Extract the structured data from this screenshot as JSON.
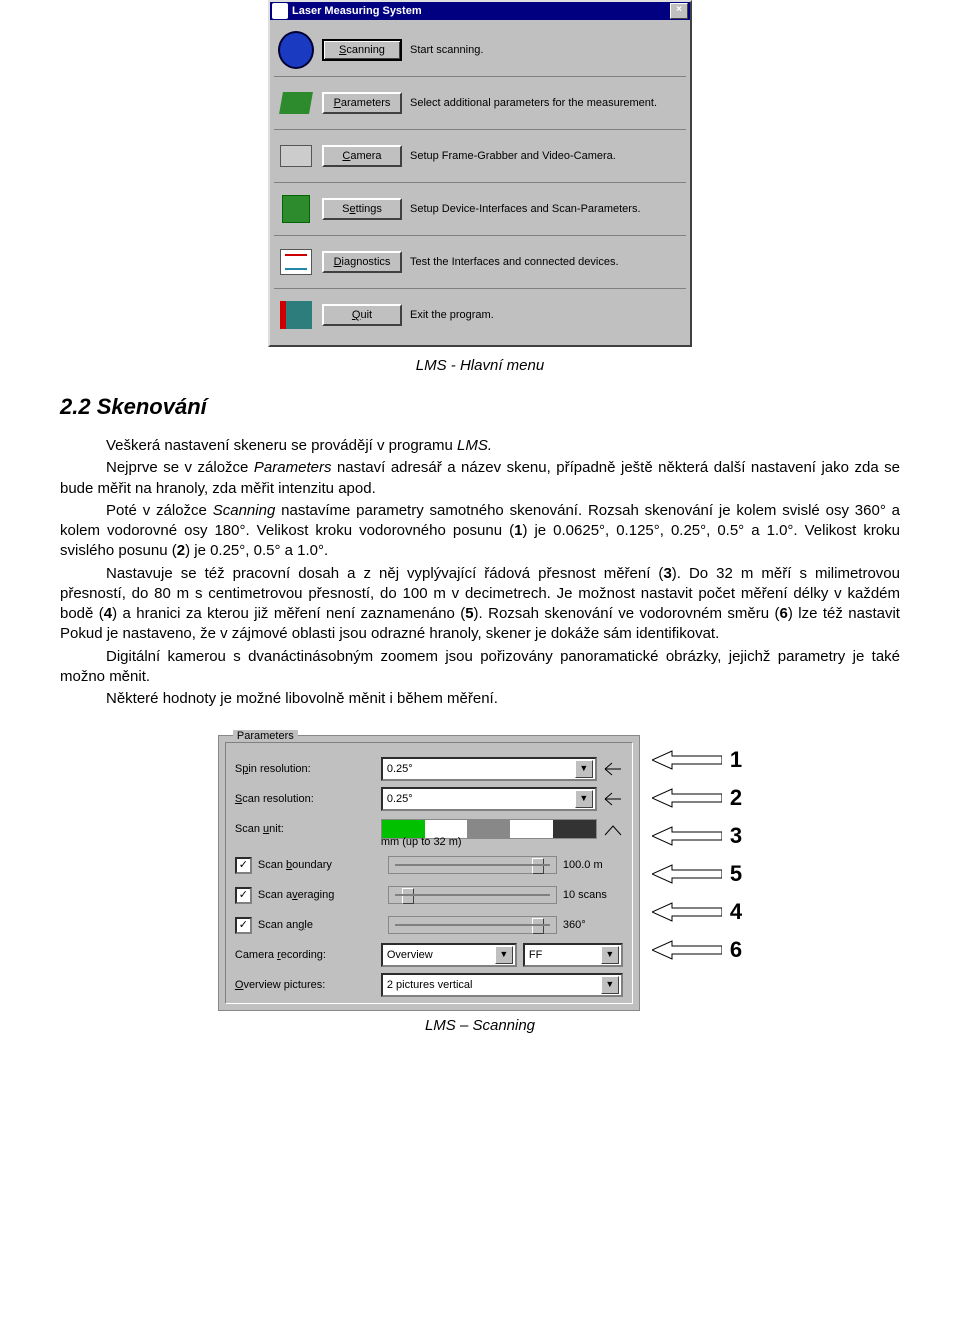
{
  "main_dialog": {
    "title": "Laser Measuring System",
    "rows": [
      {
        "button": "Scanning",
        "desc": "Start scanning."
      },
      {
        "button": "Parameters",
        "desc": "Select additional parameters for the measurement."
      },
      {
        "button": "Camera",
        "desc": "Setup Frame-Grabber and Video-Camera."
      },
      {
        "button": "Settings",
        "desc": "Setup Device-Interfaces and Scan-Parameters."
      },
      {
        "button": "Diagnostics",
        "desc": "Test the Interfaces and connected devices."
      },
      {
        "button": "Quit",
        "desc": "Exit the program."
      }
    ]
  },
  "caption1": "LMS - Hlavní menu",
  "heading": "2.2   Skenování",
  "paragraphs": {
    "p1a": "Veškerá nastavení skeneru se provádějí v programu ",
    "p1b": "LMS.",
    "p2a": "Nejprve se v záložce ",
    "p2b": "Parameters",
    "p2c": " nastaví adresář a název skenu, případně ještě některá další nastavení jako zda se bude měřit na hranoly, zda měřit intenzitu apod.",
    "p3a": "Poté v záložce ",
    "p3b": "Scanning",
    "p3c": " nastavíme parametry samotného skenování. Rozsah skenování je kolem svislé osy 360° a kolem vodorovné osy 180°. Velikost kroku vodorovného posunu (",
    "p3d": "1",
    "p3e": ") je 0.0625°, 0.125°, 0.25°, 0.5° a 1.0°. Velikost kroku svislého posunu (",
    "p3f": "2",
    "p3g": ") je 0.25°, 0.5° a 1.0°.",
    "p4a": "Nastavuje se též pracovní dosah a z něj vyplývající řádová přesnost měření (",
    "p4b": "3",
    "p4c": "). Do 32 m měří s milimetrovou přesností, do 80 m s centimetrovou přesností, do 100 m v decimetrech. Je možnost nastavit počet měření délky v každém bodě (",
    "p4d": "4",
    "p4e": ") a hranici za kterou již měření není zaznamenáno (",
    "p4f": "5",
    "p4g": "). Rozsah skenování ve vodorovném směru (",
    "p4h": "6",
    "p4i": ") lze též nastavit  Pokud je nastaveno, že v zájmové oblasti jsou odrazné hranoly, skener je dokáže sám identifikovat.",
    "p5": "Digitální kamerou s dvanáctinásobným zoomem jsou pořizovány panoramatické obrázky, jejichž parametry je také možno měnit.",
    "p6": "Některé hodnoty je možné libovolně měnit i během měření."
  },
  "params_dialog": {
    "group": "Parameters",
    "spin_label": "Spin resolution:",
    "spin_value": "0.25°",
    "scan_label": "Scan resolution:",
    "scan_value": "0.25°",
    "unit_label": "Scan unit:",
    "unit_value": "mm (up to 32 m)",
    "boundary_label": "Scan boundary",
    "boundary_value": "100.0 m",
    "averaging_label": "Scan averaging",
    "averaging_value": "10 scans",
    "angle_label": "Scan angle",
    "angle_value": "360°",
    "camera_label": "Camera recording:",
    "camera_value": "Overview",
    "ff_value": "FF",
    "overview_label": "Overview pictures:",
    "overview_value": "2 pictures vertical"
  },
  "arrows": [
    "1",
    "2",
    "3",
    "5",
    "4",
    "6"
  ],
  "caption2": "LMS – Scanning"
}
